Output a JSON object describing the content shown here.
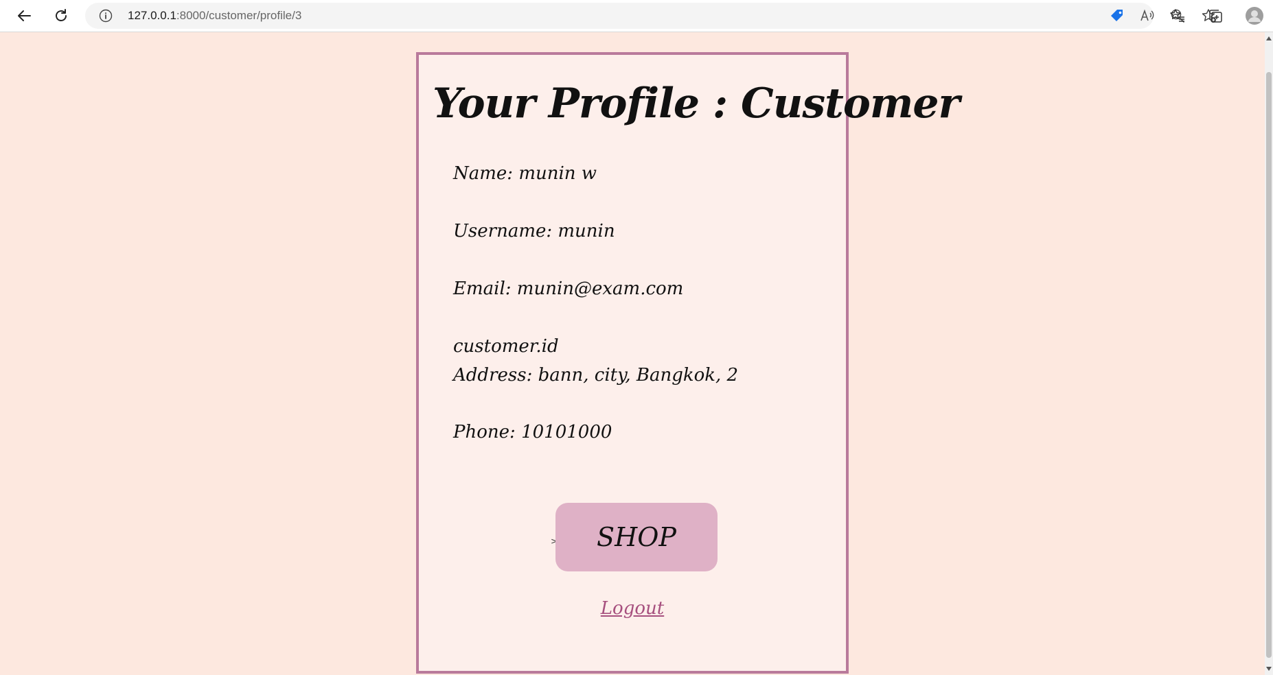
{
  "browser": {
    "url_host": "127.0.0.1",
    "url_rest": ":8000/customer/profile/3",
    "icons": {
      "back": "back-arrow-icon",
      "reload": "reload-icon",
      "info": "info-icon",
      "tag": "shopping-tag-icon",
      "read_aloud": "read-aloud-icon",
      "zoom": "zoom-out-icon",
      "add_favorite": "add-favorite-icon",
      "favorites": "favorites-icon",
      "collections": "collections-icon",
      "profile": "profile-avatar-icon"
    }
  },
  "profile": {
    "title": "Your Profile : Customer",
    "name_label": "Name:",
    "name_value": "munin w",
    "username_label": "Username:",
    "username_value": "munin",
    "email_label": "Email:",
    "email_value": "munin@exam.com",
    "customer_id_text": "customer.id",
    "address_label": "Address:",
    "address_value": "bann, city, Bangkok, 2",
    "phone_label": "Phone:",
    "phone_value": "10101000",
    "stray_text": ">",
    "shop_button": "SHOP",
    "logout_link": "Logout"
  },
  "colors": {
    "page_background": "#fde8df",
    "card_background": "#fdefeb",
    "card_border": "#b97a9b",
    "shop_button": "#dfb1c6",
    "logout_link": "#a64f7e"
  }
}
